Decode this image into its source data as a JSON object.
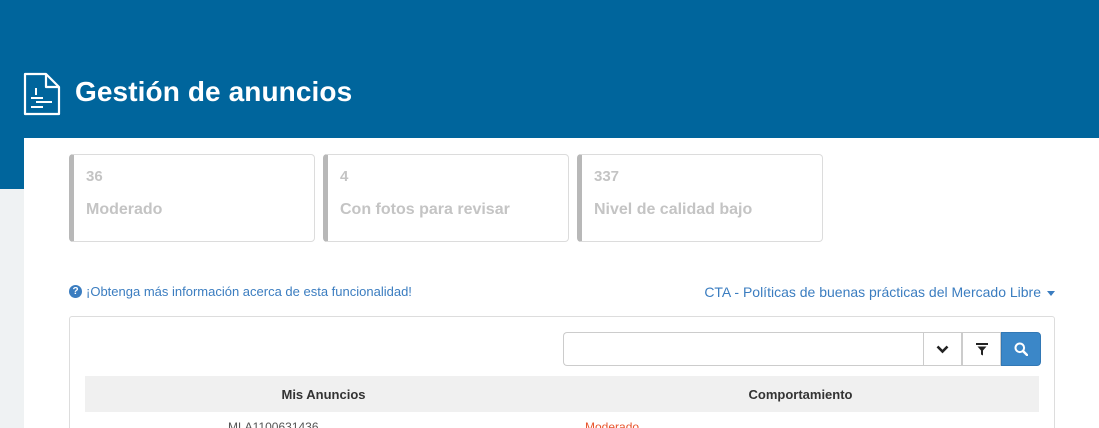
{
  "header": {
    "title": "Gestión de anuncios",
    "icon": "document-icon",
    "color": "#00659c"
  },
  "cards": [
    {
      "count": "36",
      "label": "Moderado"
    },
    {
      "count": "4",
      "label": "Con fotos para revisar"
    },
    {
      "count": "337",
      "label": "Nivel de calidad bajo"
    }
  ],
  "links": {
    "info": "¡Obtenga más información acerca de esta funcionalidad!",
    "cta": "CTA - Políticas de buenas prácticas del Mercado Libre"
  },
  "search": {
    "value": "",
    "placeholder": ""
  },
  "table": {
    "columns": [
      "Mis Anuncios",
      "Comportamiento"
    ],
    "rows": [
      {
        "id": "MLA1100631436",
        "status": "Moderado"
      }
    ]
  },
  "colors": {
    "accent": "#3b87c8",
    "link": "#3b7dc0",
    "warning": "#e8542c"
  }
}
